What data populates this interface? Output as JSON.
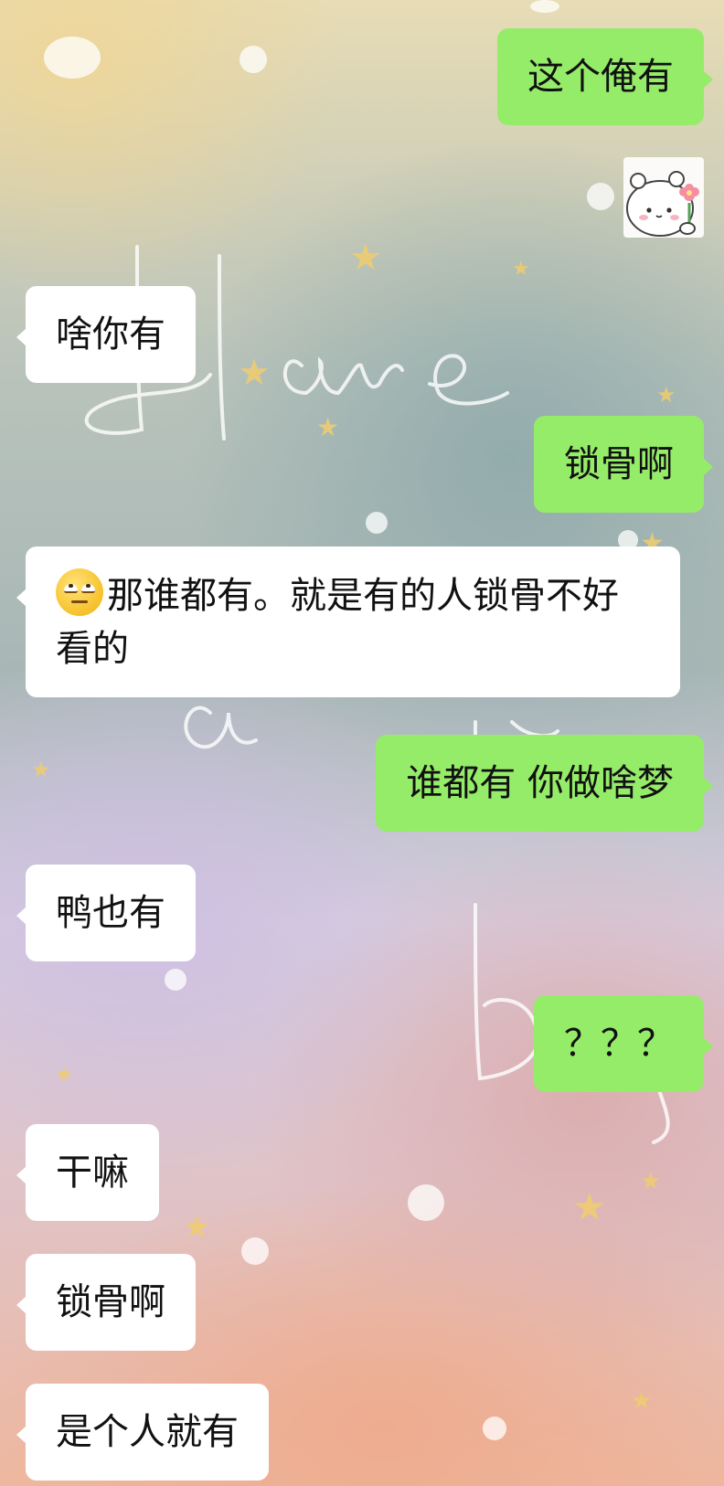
{
  "chat": {
    "messages": [
      {
        "side": "right",
        "text": "这个俺有"
      },
      {
        "side": "right",
        "sticker": "bear-with-flower-sticker"
      },
      {
        "side": "left",
        "text": "啥你有"
      },
      {
        "side": "right",
        "text": "锁骨啊"
      },
      {
        "side": "left",
        "emoji": "eye-roll-emoji",
        "text": "那谁都有。就是有的人锁骨不好看的"
      },
      {
        "side": "right",
        "text": "谁都有 你做啥梦"
      },
      {
        "side": "left",
        "text": "鸭也有"
      },
      {
        "side": "right",
        "text": "？？？"
      },
      {
        "side": "left",
        "text": "干嘛"
      },
      {
        "side": "left",
        "text": "锁骨啊"
      },
      {
        "side": "left",
        "text": "是个人就有"
      }
    ]
  },
  "colors": {
    "outgoing_bubble": "#95ec69",
    "incoming_bubble": "#ffffff",
    "text": "#111111"
  }
}
